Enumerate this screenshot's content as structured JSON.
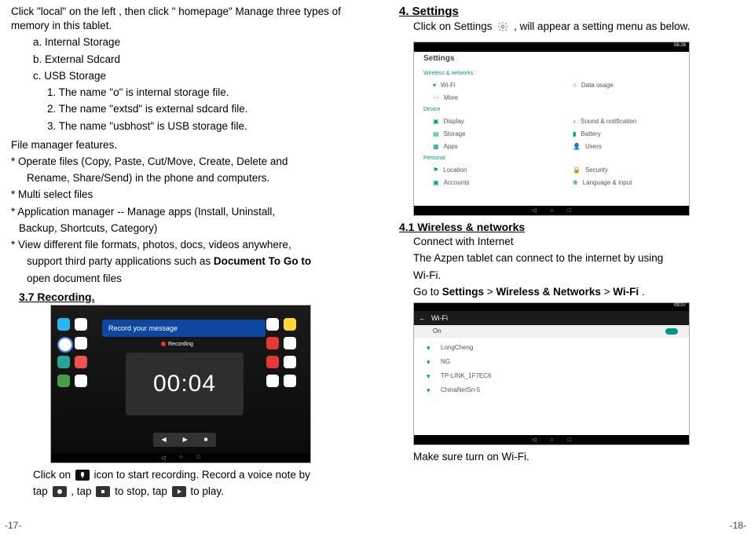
{
  "left": {
    "intro": "Click \"local\" on the left ,   then click \" homepage\" Manage three types of memory in this tablet.",
    "a": "a. Internal Storage",
    "b": "b. External Sdcard",
    "c": "c. USB Storage",
    "l1": "1. The name \"o\" is internal storage  file.",
    "l2": "2. The name \"extsd\" is external sdcard file.",
    "l3": "3. The name \"usbhost\" is USB storage file.",
    "feat_title": "File manager features.",
    "feat1a": "* Operate files (Copy, Paste, Cut/Move, Create, Delete and",
    "feat1b": "Rename, Share/Send) in the phone and computers.",
    "feat2": "* Multi select files",
    "feat3a": "* Application manager -- Manage apps (Install, Uninstall,",
    "feat3b": "Backup, Shortcuts, Category)",
    "feat4a": "* View different file formats, photos, docs, videos anywhere,",
    "feat4b": "support third party applications such as ",
    "feat4bold": "Document To Go to",
    "feat4c": "open document files",
    "sec37": "3.7 Recording.",
    "rec_bar": "Record your message",
    "rec_timer": "00:04",
    "rec_lbl": "Recording",
    "rec_line1": "Click on ",
    "rec_line1b": " icon to start recording. Record a voice note by",
    "rec_line2a": "tap ",
    "rec_line2b": " , tap ",
    "rec_line2c": " to stop, tap ",
    "rec_line2d": " to play.",
    "pagenum": "-17-"
  },
  "right": {
    "s4": "4. Settings",
    "s4line": "Click on Settings ",
    "s4lineb": " , will appear a setting menu as below.",
    "clock": "06:26",
    "settings_title": "Settings",
    "cat1": "Wireless & networks",
    "r1a": "Wi-Fi",
    "r1b": "Data usage",
    "r2a": "More",
    "cat2": "Device",
    "r3a": "Display",
    "r3b": "Sound & notification",
    "r4a": "Storage",
    "r4b": "Battery",
    "r5a": "Apps",
    "r5b": "Users",
    "cat3": "Personal",
    "r6a": "Location",
    "r6b": "Security",
    "r7a": "Accounts",
    "r7b": "Language & input",
    "s41": "4.1 Wireless & networks",
    "s41a": "Connect with Internet",
    "s41b": "The Azpen tablet can connect to the internet by using",
    "s41c": "Wi-Fi.",
    "s41d_a": "Go to ",
    "s41d_b": "Settings",
    "s41d_c": " > ",
    "s41d_d": "Wireless & Networks",
    "s41d_e": " > ",
    "s41d_f": "Wi-Fi",
    "s41d_g": " .",
    "wifi_title": "Wi-Fi",
    "wifi_clock": "09:07",
    "wifi_on": "On",
    "n1": "LongCheng",
    "n2": "NG",
    "n3": "TP-LINK_1F7EC6",
    "n4": "ChinaNetSn-5",
    "lastline": "Make sure turn on Wi-Fi.",
    "pagenum": "-18-"
  }
}
